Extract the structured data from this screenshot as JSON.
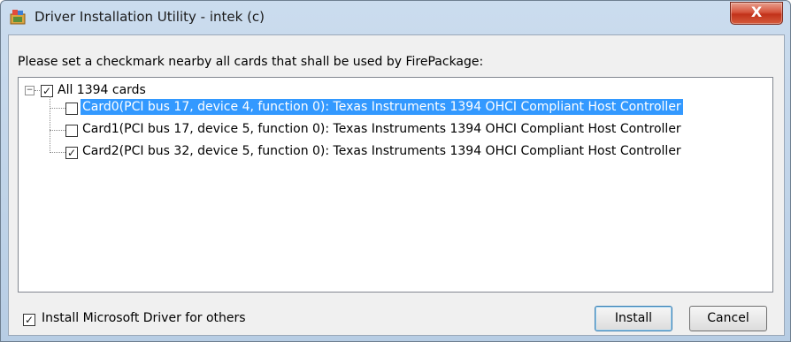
{
  "window": {
    "title": "Driver Installation Utility - intek (c)",
    "close_glyph": "X"
  },
  "instruction": "Please set a checkmark nearby all cards that shall be used by FirePackage:",
  "tree": {
    "root": {
      "label": "All 1394 cards",
      "checked": true,
      "expanded": true,
      "expander_glyph": "−",
      "check_glyph": "✓"
    },
    "items": [
      {
        "label": "Card0(PCI bus 17, device 4, function 0): Texas Instruments 1394 OHCI Compliant Host Controller",
        "checked": false,
        "selected": true,
        "check_glyph": ""
      },
      {
        "label": "Card1(PCI bus 17, device 5, function 0): Texas Instruments 1394 OHCI Compliant Host Controller",
        "checked": false,
        "selected": false,
        "check_glyph": ""
      },
      {
        "label": "Card2(PCI bus 32, device 5, function 0): Texas Instruments 1394 OHCI Compliant Host Controller",
        "checked": true,
        "selected": false,
        "check_glyph": "✓"
      }
    ]
  },
  "install_ms_driver": {
    "label": "Install Microsoft Driver for others",
    "checked": true,
    "check_glyph": "✓"
  },
  "buttons": {
    "install": "Install",
    "cancel": "Cancel"
  },
  "colors": {
    "selection": "#3399ff",
    "title_gradient_top": "#cbdcee",
    "close": "#c2321a"
  },
  "icons": [
    "app-icon",
    "close-icon",
    "tree-expander-icon",
    "checkbox-icon"
  ]
}
